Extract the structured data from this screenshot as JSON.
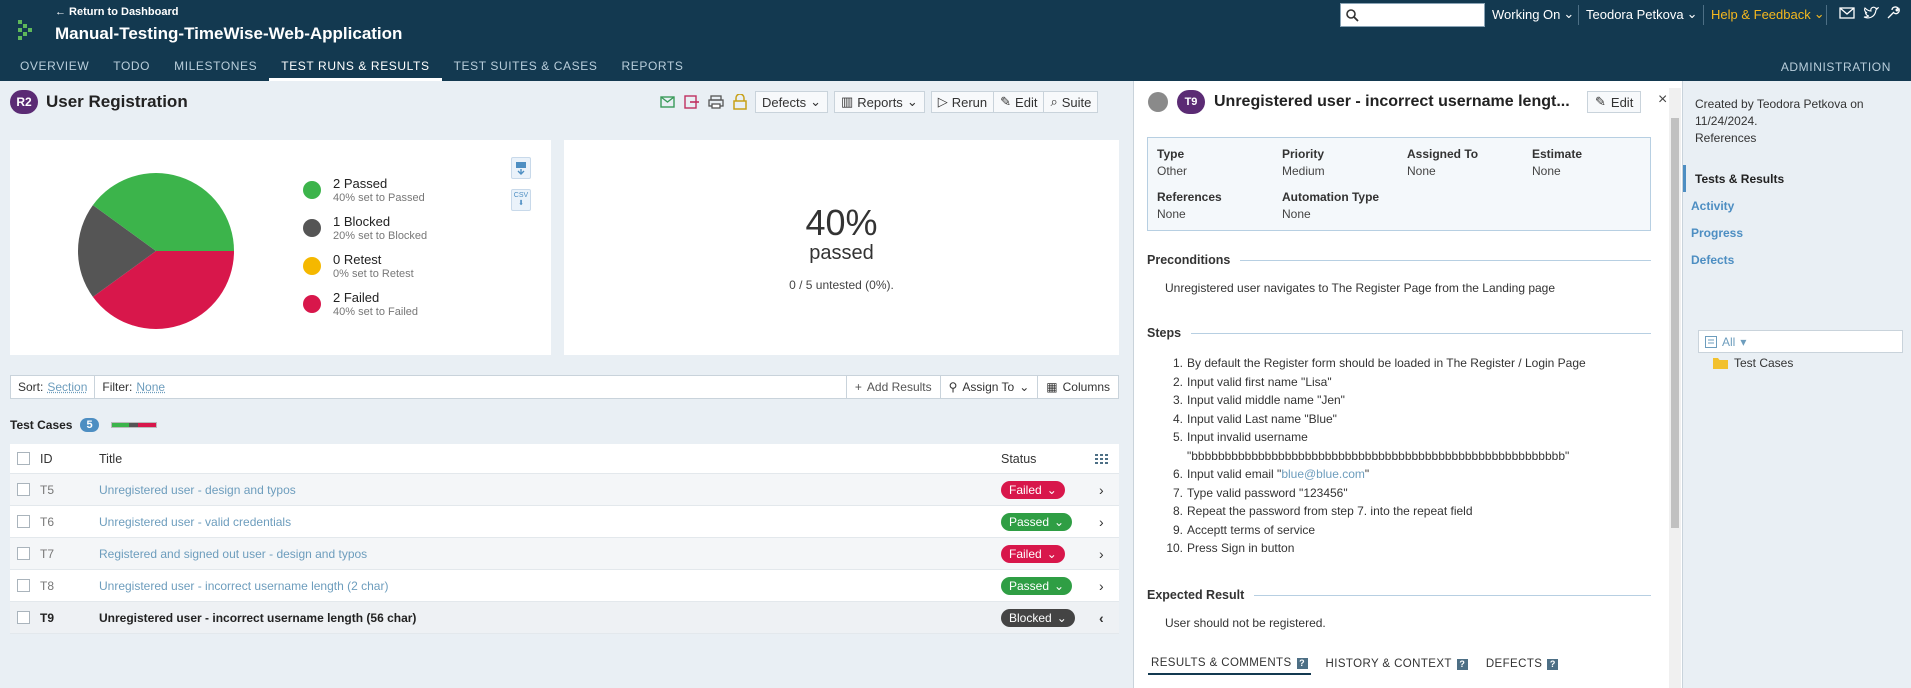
{
  "header": {
    "return_link": "← Return to Dashboard",
    "project_title": "Manual-Testing-TimeWise-Web-Application",
    "search_placeholder": "",
    "working_on": "Working On",
    "user_name": "Teodora Petkova",
    "help": "Help & Feedback",
    "nav": [
      "OVERVIEW",
      "TODO",
      "MILESTONES",
      "TEST RUNS & RESULTS",
      "TEST SUITES & CASES",
      "REPORTS"
    ],
    "active_nav": "TEST RUNS & RESULTS",
    "admin": "ADMINISTRATION",
    "colors": {
      "bar": "#133950",
      "help": "#f5b81e"
    }
  },
  "run": {
    "badge": "R2",
    "title": "User Registration",
    "toolbar": {
      "defects": "Defects",
      "reports": "Reports",
      "rerun": "Rerun",
      "edit": "Edit",
      "suite": "Suite"
    }
  },
  "summary": {
    "legend": [
      {
        "label": "2 Passed",
        "sub": "40% set to Passed",
        "color": "#3cb44b"
      },
      {
        "label": "1 Blocked",
        "sub": "20% set to Blocked",
        "color": "#555555"
      },
      {
        "label": "0 Retest",
        "sub": "0% set to Retest",
        "color": "#f5b800"
      },
      {
        "label": "2 Failed",
        "sub": "40% set to Failed",
        "color": "#d8174b"
      }
    ],
    "pie_fractions": {
      "passed": 0.4,
      "blocked": 0.2,
      "retest": 0.0,
      "failed": 0.4
    },
    "percent": "40%",
    "passed_label": "passed",
    "untested": "0 / 5 untested (0%).",
    "csv_label": "CSV"
  },
  "filterbar": {
    "sort_label": "Sort:",
    "sort_value": "Section",
    "filter_label": "Filter:",
    "filter_value": "None",
    "add_results": "Add Results",
    "assign_to": "Assign To",
    "columns": "Columns"
  },
  "test_cases": {
    "header": "Test Cases",
    "count": "5",
    "columns": {
      "id": "ID",
      "title": "Title",
      "status": "Status"
    },
    "rows": [
      {
        "id": "T5",
        "title": "Unregistered user - design and typos",
        "status": "Failed",
        "color": "#d8174b"
      },
      {
        "id": "T6",
        "title": "Unregistered user - valid credentials",
        "status": "Passed",
        "color": "#2f9e44"
      },
      {
        "id": "T7",
        "title": "Registered and signed out user - design and typos",
        "status": "Failed",
        "color": "#d8174b"
      },
      {
        "id": "T8",
        "title": "Unregistered user - incorrect username length (2 char)",
        "status": "Passed",
        "color": "#2f9e44"
      },
      {
        "id": "T9",
        "title": "Unregistered user - incorrect username length (56 char)",
        "status": "Blocked",
        "color": "#444444"
      }
    ]
  },
  "case": {
    "badge": "T9",
    "title": "Unregistered user - incorrect username lengt...",
    "edit": "Edit",
    "close": "×",
    "props": {
      "type_label": "Type",
      "type_value": "Other",
      "priority_label": "Priority",
      "priority_value": "Medium",
      "assigned_label": "Assigned To",
      "assigned_value": "None",
      "estimate_label": "Estimate",
      "estimate_value": "None",
      "references_label": "References",
      "references_value": "None",
      "automation_label": "Automation Type",
      "automation_value": "None"
    },
    "preconditions_h": "Preconditions",
    "preconditions": "Unregistered user navigates to The Register Page from the Landing page",
    "steps_h": "Steps",
    "steps": [
      "By default the Register form should be loaded in The Register / Login Page",
      "Input valid first name \"Lisa\"",
      "Input valid middle name \"Jen\"",
      "Input valid Last name \"Blue\"",
      "Input invalid username",
      "Input valid email \"",
      "Type valid password \"123456\"",
      "Repeat the password from step 7. into the repeat field",
      "Acceptt terms of service",
      "Press Sign in button"
    ],
    "step5_cont": "\"bbbbbbbbbbbbbbbbbbbbbbbbbbbbbbbbbbbbbbbbbbbbbbbbbbbbbbbb\"",
    "email_link": "blue@blue.com",
    "email_close": "\"",
    "expected_h": "Expected Result",
    "expected": "User should not be registered.",
    "tabs": [
      "RESULTS & COMMENTS",
      "HISTORY & CONTEXT",
      "DEFECTS"
    ],
    "qmark": "?"
  },
  "sidebar": {
    "created": "Created by Teodora Petkova on 11/24/2024.",
    "references": "References",
    "nav": [
      "Tests & Results",
      "Activity",
      "Progress",
      "Defects"
    ],
    "filter": "All",
    "tree_item": "Test Cases"
  }
}
